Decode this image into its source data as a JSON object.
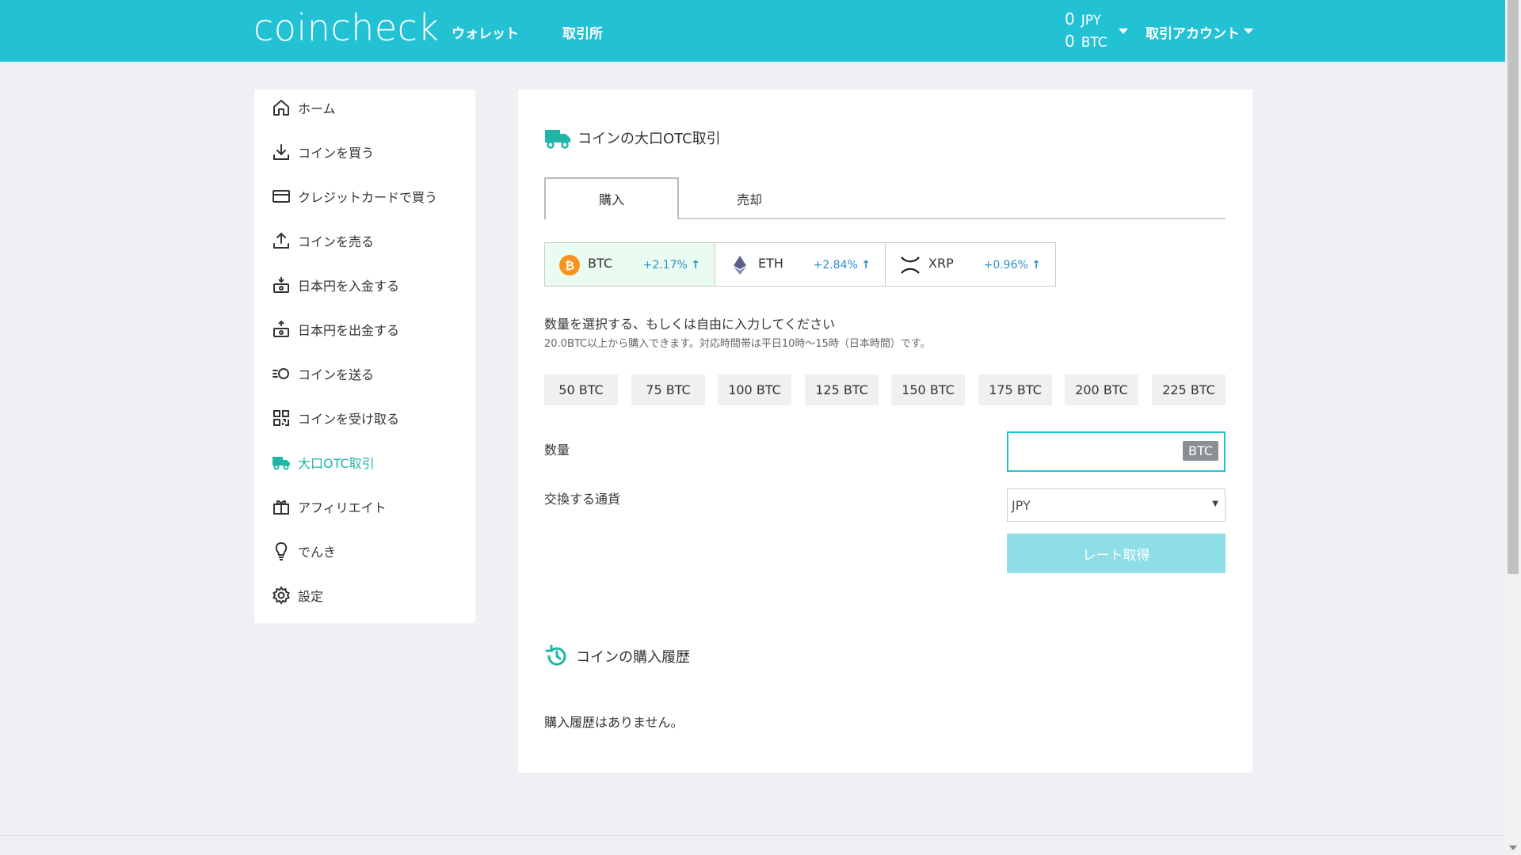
{
  "header": {
    "logo": "coincheck",
    "nav": [
      "ウォレット",
      "取引所"
    ],
    "balances": [
      {
        "amount": "0",
        "unit": "JPY"
      },
      {
        "amount": "0",
        "unit": "BTC"
      }
    ],
    "account_label": "取引アカウント"
  },
  "sidebar": {
    "items": [
      {
        "label": "ホーム",
        "icon": "home-icon"
      },
      {
        "label": "コインを買う",
        "icon": "download-icon"
      },
      {
        "label": "クレジットカードで買う",
        "icon": "credit-card-icon"
      },
      {
        "label": "コインを売る",
        "icon": "upload-icon"
      },
      {
        "label": "日本円を入金する",
        "icon": "deposit-icon"
      },
      {
        "label": "日本円を出金する",
        "icon": "withdraw-icon"
      },
      {
        "label": "コインを送る",
        "icon": "send-icon"
      },
      {
        "label": "コインを受け取る",
        "icon": "qr-code-icon"
      },
      {
        "label": "大口OTC取引",
        "icon": "truck-icon",
        "active": true
      },
      {
        "label": "アフィリエイト",
        "icon": "gift-icon"
      },
      {
        "label": "でんき",
        "icon": "lightbulb-icon"
      },
      {
        "label": "設定",
        "icon": "gear-icon"
      }
    ]
  },
  "main": {
    "title": "コインの大口OTC取引",
    "tabs": [
      "購入",
      "売却"
    ],
    "coins": [
      {
        "symbol": "BTC",
        "change": "+2.17%",
        "icon": "bitcoin-icon"
      },
      {
        "symbol": "ETH",
        "change": "+2.84%",
        "icon": "ethereum-icon"
      },
      {
        "symbol": "XRP",
        "change": "+0.96%",
        "icon": "xrp-icon"
      }
    ],
    "hint_main": "数量を選択する、もしくは自由に入力してください",
    "hint_sub": "20.0BTC以上から購入できます。対応時間帯は平日10時〜15時（日本時間）です。",
    "quantity_options": [
      "50 BTC",
      "75 BTC",
      "100 BTC",
      "125 BTC",
      "150 BTC",
      "175 BTC",
      "200 BTC",
      "225 BTC"
    ],
    "amount_label": "数量",
    "amount_unit": "BTC",
    "amount_value": "",
    "currency_label": "交換する通貨",
    "currency_value": "JPY",
    "rate_button": "レート取得",
    "history_title": "コインの購入履歴",
    "history_empty": "購入履歴はありません。"
  },
  "colors": {
    "brand": "#23c1d4",
    "active_sidebar": "#1fb6a7",
    "change_up": "#2a8fcf"
  }
}
